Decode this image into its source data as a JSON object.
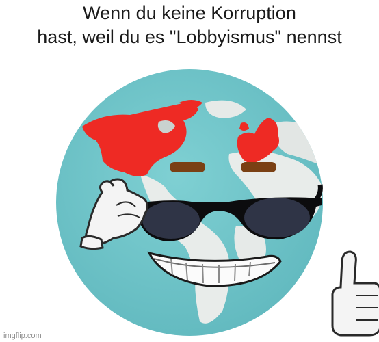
{
  "meme": {
    "caption_line1": "Wenn du keine Korruption",
    "caption_line2": "hast, weil du es \"Lobbyismus\" nennst",
    "watermark": "imgflip.com"
  },
  "icons": [
    "globe-icon",
    "sunglasses-icon",
    "gloved-hand-icon",
    "thumbs-up-icon"
  ],
  "colors": {
    "ocean": "#6cc3c7",
    "land": "#e8ecea",
    "highlight_regions": "#ee2a24",
    "lenses": "#2f3446",
    "eyebrows": "#7a4014"
  }
}
